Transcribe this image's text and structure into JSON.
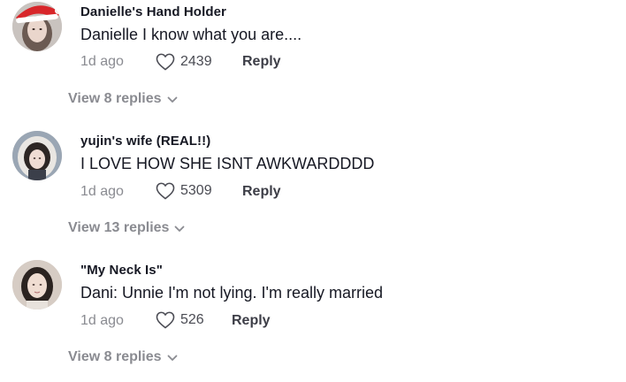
{
  "comments": [
    {
      "author": "Danielle's Hand Holder",
      "text": "Danielle I know what you are....",
      "time": "1d ago",
      "likes": "2439",
      "reply_label": "Reply",
      "view_replies": "View 8 replies",
      "avatar_icon": "user-avatar-santa-hat"
    },
    {
      "author": "yujin's wife (REAL!!)",
      "text": "I LOVE HOW SHE ISNT AWKWARDDDD",
      "time": "1d ago",
      "likes": "5309",
      "reply_label": "Reply",
      "view_replies": "View 13 replies",
      "avatar_icon": "user-avatar"
    },
    {
      "author": "\"My Neck Is\"",
      "text": "Dani: Unnie I'm not lying. I'm really married",
      "time": "1d ago",
      "likes": "526",
      "reply_label": "Reply",
      "view_replies": "View 8 replies",
      "avatar_icon": "user-avatar"
    }
  ],
  "colors": {
    "primary_text": "#161823",
    "secondary_text": "#8a8b91",
    "background": "#ffffff"
  }
}
